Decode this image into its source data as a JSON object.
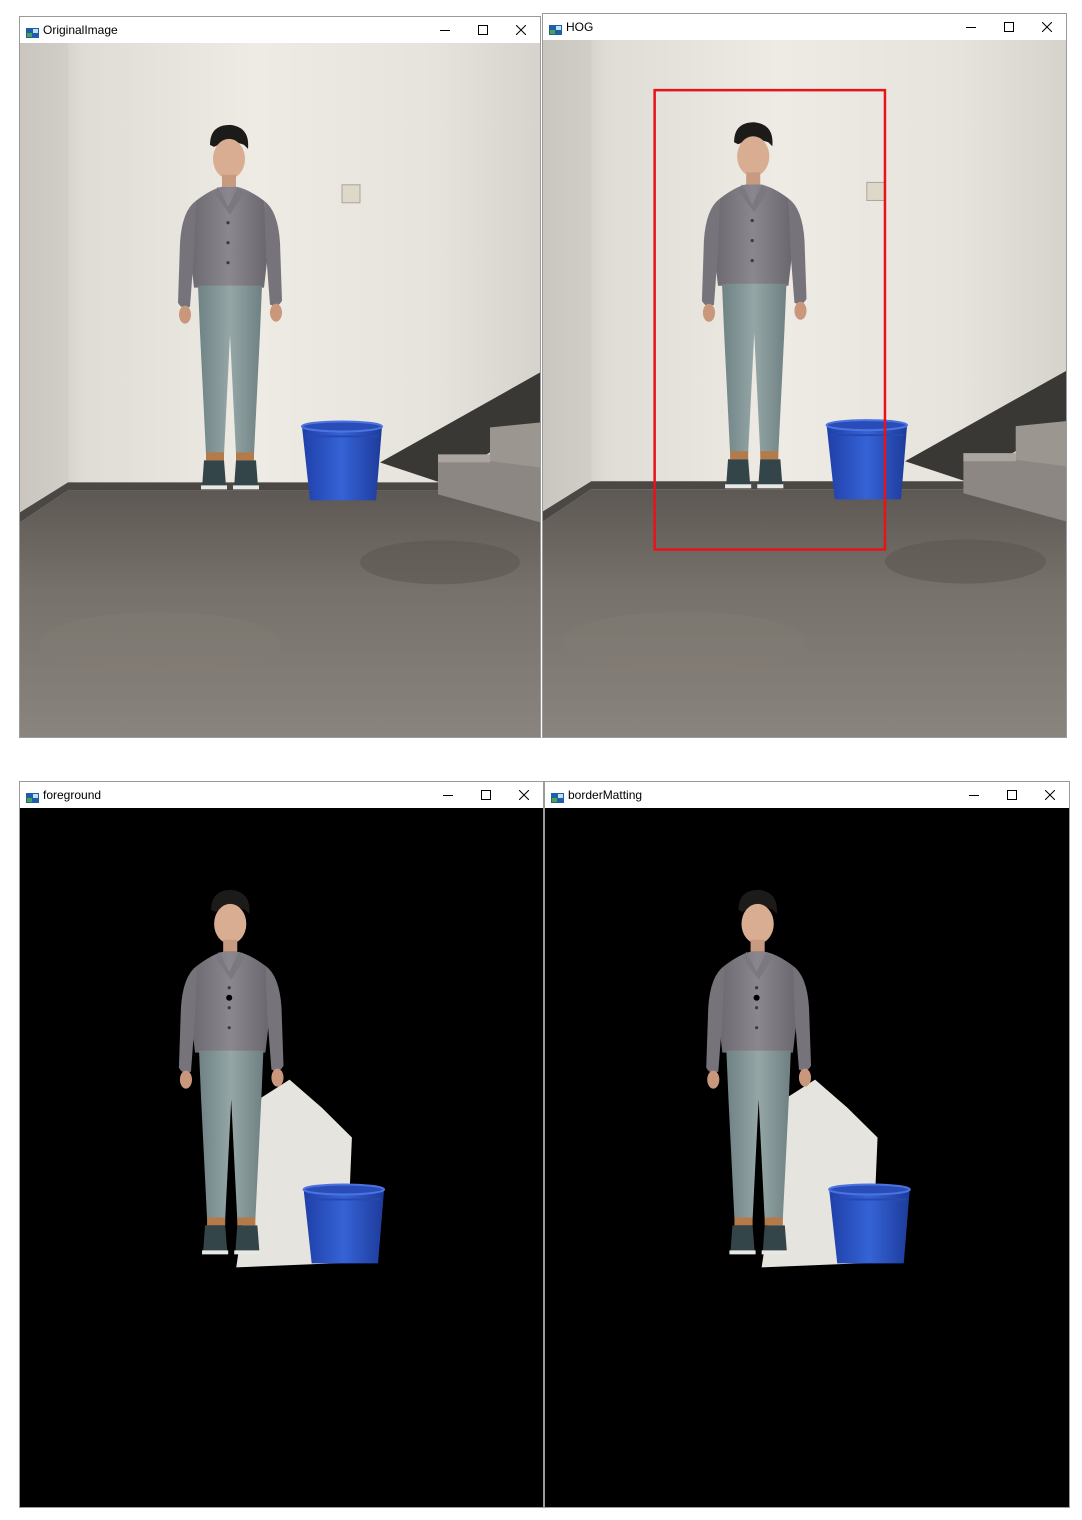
{
  "windows": [
    {
      "id": "original",
      "title": "OriginalImage"
    },
    {
      "id": "hog",
      "title": "HOG"
    },
    {
      "id": "foreground",
      "title": "foreground"
    },
    {
      "id": "border",
      "title": "borderMatting"
    }
  ],
  "controls": {
    "minimize": "–",
    "maximize": "☐",
    "close": "✕"
  },
  "colors": {
    "detection_box": "#e8121a",
    "bucket": "#2e57c6",
    "wall": "#e9e7e1",
    "floor": "#6f6a65"
  },
  "icons": [
    "app-icon",
    "minimize-icon",
    "maximize-icon",
    "close-icon"
  ]
}
